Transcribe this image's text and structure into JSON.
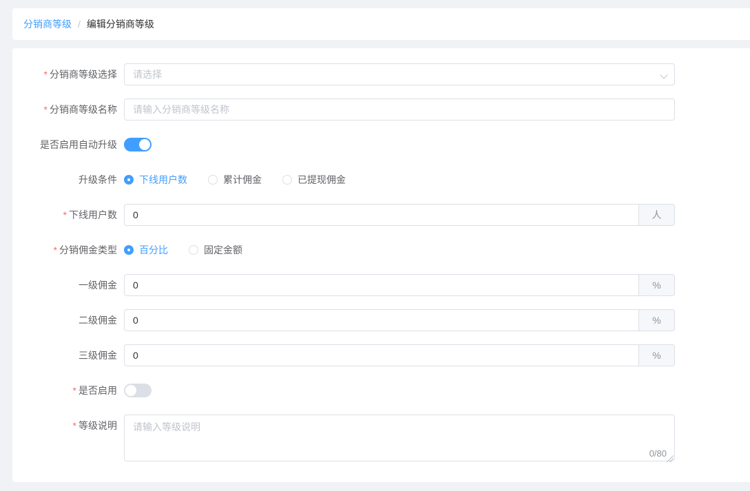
{
  "breadcrumb": {
    "root": "分销商等级",
    "separator": "/",
    "current": "编辑分销商等级"
  },
  "required_mark": "*",
  "form": {
    "level_select": {
      "label": "分销商等级选择",
      "placeholder": "请选择"
    },
    "level_name": {
      "label": "分销商等级名称",
      "placeholder": "请输入分销商等级名称"
    },
    "auto_upgrade": {
      "label": "是否启用自动升级",
      "state": "on"
    },
    "upgrade_condition": {
      "label": "升级条件",
      "options": [
        "下线用户数",
        "累计佣金",
        "已提现佣金"
      ],
      "selected": "下线用户数"
    },
    "downline_users": {
      "label": "下线用户数",
      "value": "0",
      "suffix": "人"
    },
    "commission_type": {
      "label": "分销佣金类型",
      "options": [
        "百分比",
        "固定金额"
      ],
      "selected": "百分比"
    },
    "commission_level1": {
      "label": "一级佣金",
      "value": "0",
      "suffix": "%"
    },
    "commission_level2": {
      "label": "二级佣金",
      "value": "0",
      "suffix": "%"
    },
    "commission_level3": {
      "label": "三级佣金",
      "value": "0",
      "suffix": "%"
    },
    "enabled": {
      "label": "是否启用",
      "state": "off"
    },
    "description": {
      "label": "等级说明",
      "placeholder": "请输入等级说明",
      "counter": "0/80"
    }
  },
  "colors": {
    "primary": "#409eff",
    "danger": "#f56c6c",
    "border": "#dcdfe6",
    "placeholder": "#c0c4cc",
    "suffix_bg": "#f5f7fa",
    "page_bg": "#f0f2f5"
  }
}
